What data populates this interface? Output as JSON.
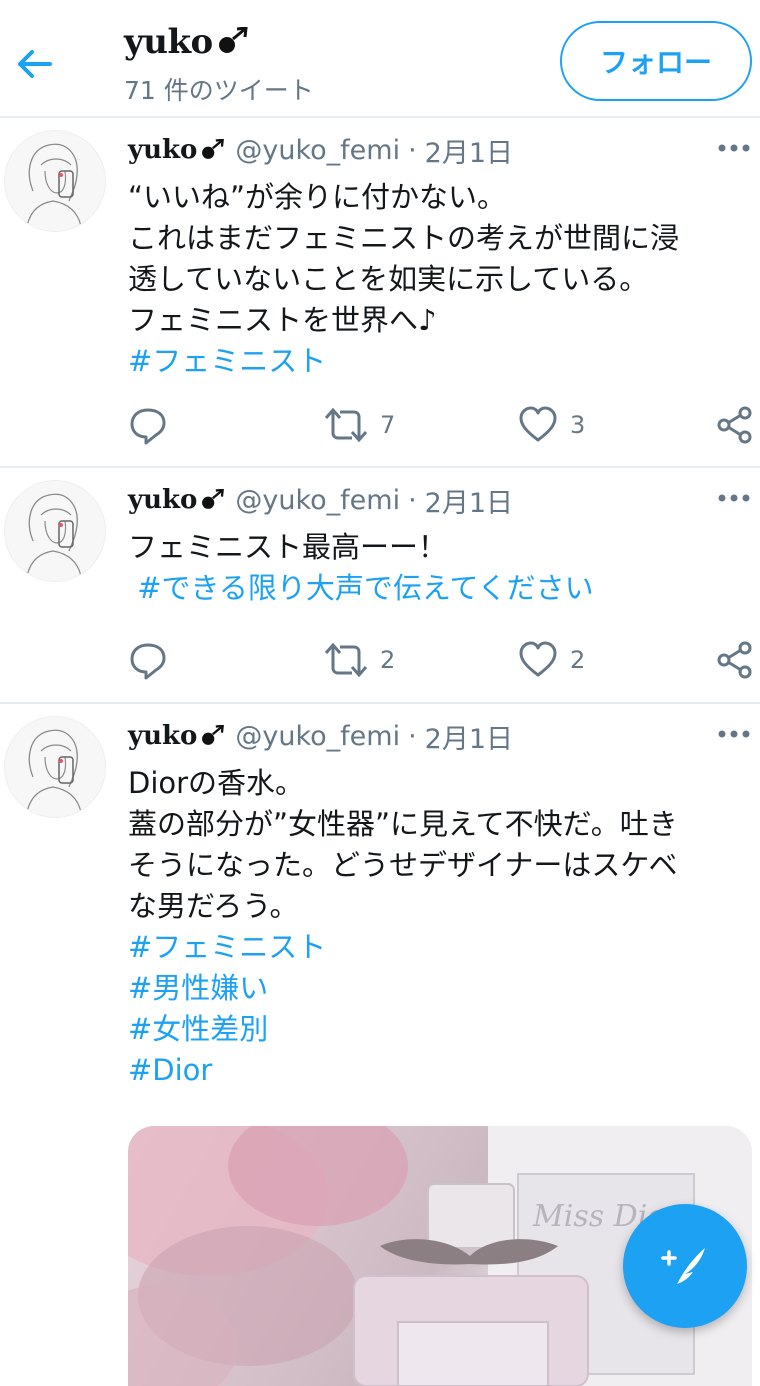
{
  "header": {
    "title": "yuko",
    "tweet_count": "71 件のツイート",
    "follow_label": "フォロー"
  },
  "colors": {
    "accent": "#1da1f2",
    "muted": "#657786",
    "text": "#14171a",
    "divider": "#e6ecf0"
  },
  "icons": {
    "back": "arrow-left-icon",
    "female_symbol": "female-symbol-icon",
    "more": "more-dots-icon",
    "reply": "reply-icon",
    "retweet": "retweet-icon",
    "like": "heart-icon",
    "share": "share-icon",
    "compose": "compose-tweet-icon"
  },
  "tweets": [
    {
      "name": "yuko",
      "handle": "@yuko_femi",
      "dot": "·",
      "date": "2月1日",
      "lines": [
        "“いいね”が余りに付かない。",
        "これはまだフェミニストの考えが世間に浸",
        "透していないことを如実に示している。",
        "フェミニストを世界へ♪"
      ],
      "tags": [
        "#フェミニスト"
      ],
      "retweets": "7",
      "likes": "3"
    },
    {
      "name": "yuko",
      "handle": "@yuko_femi",
      "dot": "·",
      "date": "2月1日",
      "lines": [
        "フェミニスト最高ーー！"
      ],
      "tags": [
        " #できる限り大声で伝えてください"
      ],
      "retweets": "2",
      "likes": "2"
    },
    {
      "name": "yuko",
      "handle": "@yuko_femi",
      "dot": "·",
      "date": "2月1日",
      "lines": [
        "Diorの香水。",
        "蓋の部分が”女性器”に見えて不快だ。吐き",
        "そうになった。どうせデザイナーはスケベ",
        "な男だろう。"
      ],
      "tags": [
        "#フェミニスト",
        "#男性嫌い",
        "#女性差別",
        "#Dior"
      ],
      "media_text": "Miss Dior"
    }
  ]
}
